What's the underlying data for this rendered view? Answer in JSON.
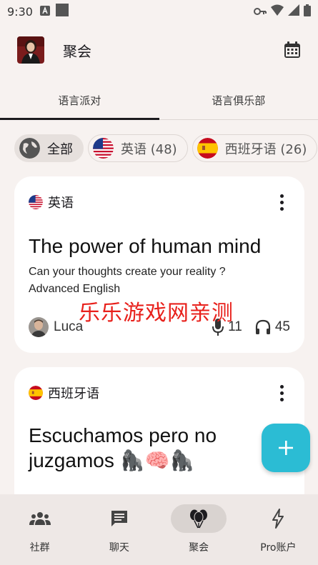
{
  "status_bar": {
    "time": "9:30"
  },
  "app_bar": {
    "title": "聚会"
  },
  "tabs": [
    {
      "label": "语言派对",
      "active": true
    },
    {
      "label": "语言俱乐部",
      "active": false
    }
  ],
  "filters": [
    {
      "label": "全部",
      "icon": "globe-icon",
      "selected": true
    },
    {
      "label": "英语 (48)",
      "icon": "us-flag-icon",
      "selected": false
    },
    {
      "label": "西班牙语 (26)",
      "icon": "spain-flag-icon",
      "selected": false
    }
  ],
  "cards": [
    {
      "language": "英语",
      "flag": "us-flag-icon",
      "title": "The power of human mind",
      "description": "Can your thoughts  create your reality ?\nAdvanced English",
      "host": "Luca",
      "speakers": "11",
      "listeners": "45"
    },
    {
      "language": "西班牙语",
      "flag": "spain-flag-icon",
      "title": "Escuchamos pero no juzgamos 🦍🧠🦍"
    }
  ],
  "watermark": "乐乐游戏网亲测",
  "bottom_nav": [
    {
      "label": "社群",
      "icon": "community-icon",
      "active": false
    },
    {
      "label": "聊天",
      "icon": "chat-icon",
      "active": false
    },
    {
      "label": "聚会",
      "icon": "balloons-icon",
      "active": true
    },
    {
      "label": "Pro账户",
      "icon": "bolt-icon",
      "active": false
    }
  ],
  "colors": {
    "accent": "#2bbcd4",
    "background": "#f7f2f0",
    "card": "#ffffff"
  }
}
